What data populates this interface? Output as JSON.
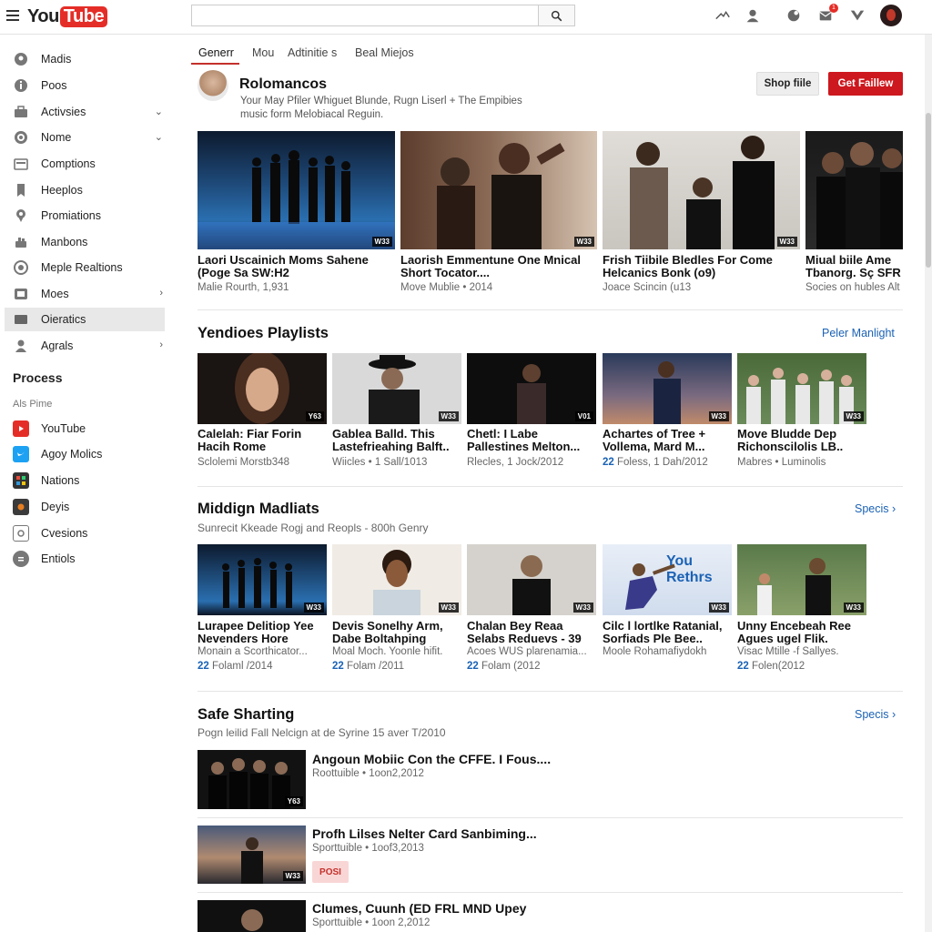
{
  "header": {
    "logo_you": "You",
    "logo_tube": "Tube",
    "search_placeholder": "",
    "notification_count": "1"
  },
  "sidebar": {
    "items": [
      {
        "label": "Madis",
        "icon": "location-icon",
        "chevron": ""
      },
      {
        "label": "Poos",
        "icon": "info-icon",
        "chevron": ""
      },
      {
        "label": "Activsies",
        "icon": "briefcase-icon",
        "chevron": "⌄"
      },
      {
        "label": "Nome",
        "icon": "target-icon",
        "chevron": "⌄"
      },
      {
        "label": "Comptions",
        "icon": "folder-icon",
        "chevron": ""
      },
      {
        "label": "Heeplos",
        "icon": "bookmark-icon",
        "chevron": ""
      },
      {
        "label": "Promiations",
        "icon": "pin-icon",
        "chevron": ""
      },
      {
        "label": "Manbons",
        "icon": "hand-icon",
        "chevron": ""
      },
      {
        "label": "Meple Realtions",
        "icon": "circle-icon",
        "chevron": ""
      },
      {
        "label": "Moes",
        "icon": "grid-icon",
        "chevron": "›"
      },
      {
        "label": "Oieratics",
        "icon": "square-icon",
        "chevron": ""
      },
      {
        "label": "Agrals",
        "icon": "person-icon",
        "chevron": "›"
      }
    ],
    "section_heading": "Process",
    "section_subheading": "Als Pime",
    "sub_items": [
      {
        "label": "YouTube",
        "icon": "youtube-icon",
        "color": "#e52d27"
      },
      {
        "label": "Agoy Molics",
        "icon": "twitter-icon",
        "color": "#1da1f2"
      },
      {
        "label": "Nations",
        "icon": "grid-app-icon",
        "color": "#333333"
      },
      {
        "label": "Deyis",
        "icon": "app-icon",
        "color": "#3b3b3b"
      },
      {
        "label": "Cvesions",
        "icon": "window-icon",
        "color": "#777777"
      },
      {
        "label": "Entiols",
        "icon": "shield-icon",
        "color": "#777777"
      }
    ]
  },
  "tabs": [
    {
      "label": "Generr"
    },
    {
      "label": "Mou"
    },
    {
      "label": "Adtinitie s"
    },
    {
      "label": "Beal Miejos"
    }
  ],
  "channel": {
    "name": "Rolomancos",
    "desc_line1": "Your May Pfiler Whiguet Blunde, Rugn Liserl + The Empibies",
    "desc_line2": "music form Melobiacal Reguin.",
    "shop_label": "Shop fiile",
    "follow_label": "Get Faillew"
  },
  "featured": [
    {
      "title": "Laori Uscainich Moms Sahene (Poge Sa SW:H2",
      "meta": "Malie Rourth, 1,931",
      "duration": "W33"
    },
    {
      "title": "Laorish Emmentune One Mnical Short Tocator....",
      "meta": "Move Mublie • 2014",
      "duration": "W33"
    },
    {
      "title": "Frish Tiibile Bledles For Come Helcanics Bonk (o9)",
      "meta": "Joace Scincin (u13",
      "duration": "W33"
    },
    {
      "title": "Miual biile Ame Tbanorg. Sç SFR",
      "meta": "Socies on hubles Alt",
      "duration": ""
    }
  ],
  "playlists": {
    "title": "Yendioes Playlists",
    "link": "Peler Manlight",
    "items": [
      {
        "title": "Calelah: Fiar Forin Hacih Rome",
        "meta_num": "",
        "meta": "Sclolemi Morstb348",
        "duration": "Y63"
      },
      {
        "title": "Gablea Balld. This Lastefrieahing Balft..",
        "meta_num": "",
        "meta": "Wiicles • 1 Sall/1013",
        "duration": "W33"
      },
      {
        "title": "Chetl: I Labe Pallestines Melton...",
        "meta_num": "",
        "meta": "Rlecles, 1 Jock/2012",
        "duration": "V01"
      },
      {
        "title": "Achartes of Tree + Vollema, Mard M...",
        "meta_num": "22",
        "meta": "Foless, 1 Dah/2012",
        "duration": "W33"
      },
      {
        "title": "Move Bludde Dep Richonscilolis LB..",
        "meta_num": "",
        "meta": "Mabres • Luminolis",
        "duration": "W33"
      }
    ]
  },
  "madlists": {
    "title": "Middign Madliats",
    "subtitle": "Sunrecit Kkeade Rogj and Reopls - 800h Genry",
    "link": "Specis ›",
    "items": [
      {
        "title": "Lurapee Delitiop Yee Nevenders Hore",
        "sub": "Monain a Scorthicator...",
        "meta_num": "22",
        "meta": "Folaml /2014",
        "duration": "W33"
      },
      {
        "title": "Devis Sonelhy Arm, Dabe Boltahping",
        "sub": "Moal Moch. Yoonle hifit.",
        "meta_num": "22",
        "meta": "Folam /2011",
        "duration": "W33"
      },
      {
        "title": "Chalan Bey Reaa Selabs Reduevs - 39",
        "sub": "Acoes WUS plarenamia...",
        "meta_num": "22",
        "meta": "Folam (2012",
        "duration": "W33"
      },
      {
        "title": "Cilc l lortlke Ratanial, Sorfiads Ple Bee..",
        "sub": "Moole Rohamafiydokh",
        "meta_num": "",
        "meta": "",
        "duration": "W33",
        "overlay": "You Rethrs"
      },
      {
        "title": "Unny Encebeah Ree Agues ugel Flik.",
        "sub": "Visac Mtille -f Sallyes.",
        "meta_num": "22",
        "meta": "Folen(2012",
        "duration": "W33"
      }
    ]
  },
  "sharting": {
    "title": "Safe Sharting",
    "subtitle": "Pogn leilid Fall Nelcign at de Syrine 15 aver T/2010",
    "link": "Specis ›",
    "items": [
      {
        "title": "Angoun Mobiic Con the CFFE. I Fous....",
        "meta": "Roottuible • 1oon2,2012",
        "duration": "Y63",
        "badge": ""
      },
      {
        "title": "Profh Lilses Nelter Card Sanbiming...",
        "meta": "Sporttuible • 1oof3,2013",
        "duration": "W33",
        "badge": "POSI"
      },
      {
        "title": "Clumes, Cuunh (ED FRL MND Upey",
        "meta": "Sporttuible • 1oon 2,2012",
        "duration": "",
        "badge": ""
      }
    ]
  }
}
